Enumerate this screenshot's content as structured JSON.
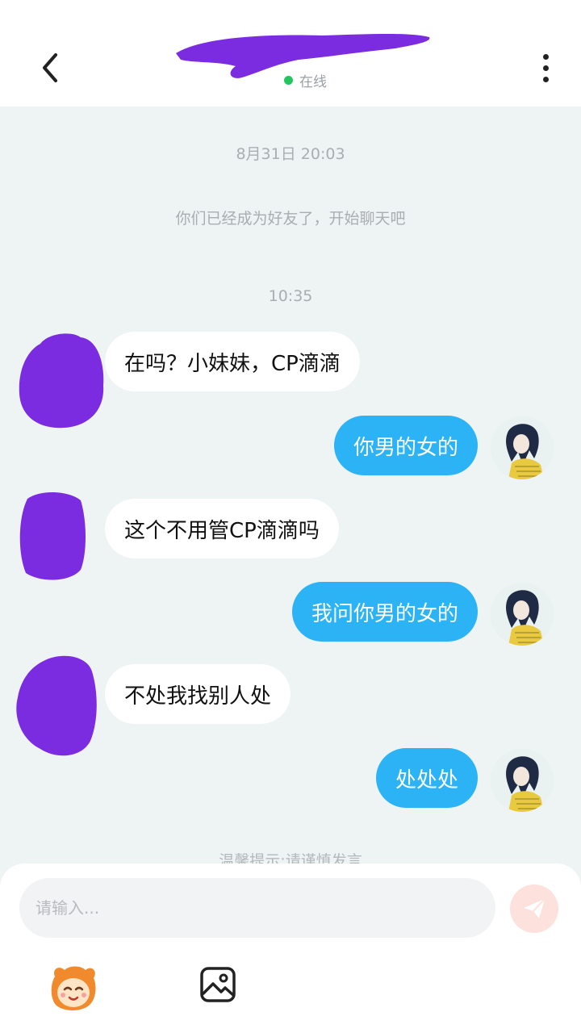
{
  "header": {
    "status_text": "在线",
    "icons": {
      "back": "chevron-left-icon",
      "more": "more-vertical-icon"
    },
    "colors": {
      "online_dot": "#22c55e"
    }
  },
  "chat": {
    "date_stamp": "8月31日 20:03",
    "system_message": "你们已经成为好友了，开始聊天吧",
    "time_stamp": "10:35",
    "messages": [
      {
        "side": "in",
        "text": "在吗？小妹妹，CP滴滴"
      },
      {
        "side": "out",
        "text": "你男的女的"
      },
      {
        "side": "in",
        "text": "这个不用管CP滴滴吗"
      },
      {
        "side": "out",
        "text": "我问你男的女的"
      },
      {
        "side": "in",
        "text": "不处我找别人处"
      },
      {
        "side": "out",
        "text": "处处处"
      }
    ],
    "tip": "温馨提示:请谨慎发言",
    "colors": {
      "out_bubble": "#2bb3f5",
      "in_bubble": "#ffffff",
      "redaction": "#7b2be0"
    }
  },
  "composer": {
    "placeholder": "请输入...",
    "icons": {
      "send": "send-icon",
      "emoji": "emoji-icon",
      "image": "image-icon"
    }
  }
}
